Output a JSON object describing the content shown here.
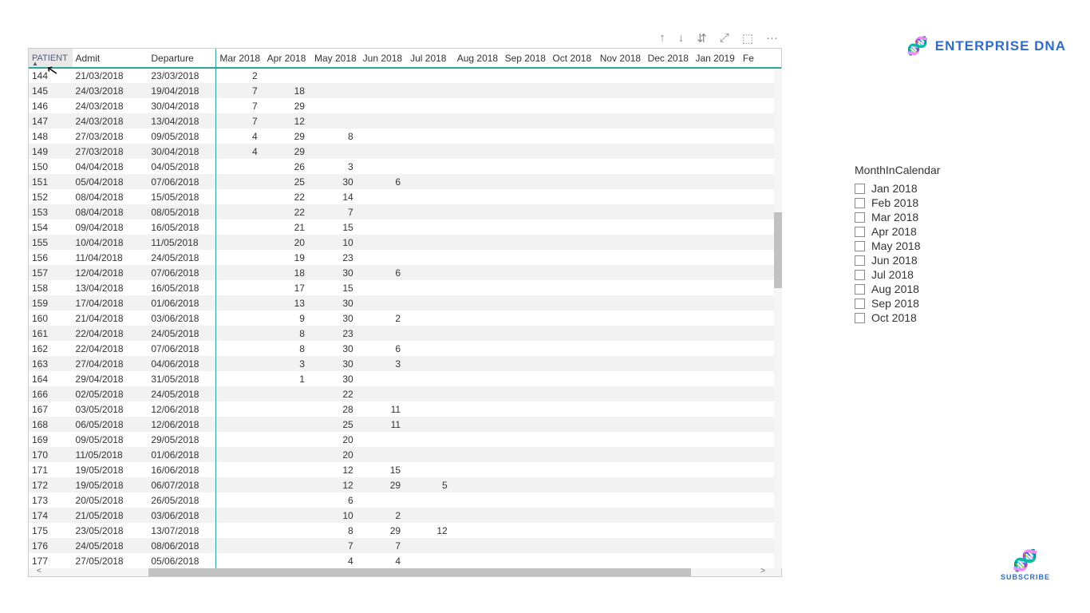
{
  "brand": {
    "left": "ENTERPRISE",
    "right": "DNA"
  },
  "subscribe": "SUBSCRIBE",
  "toolbar": {
    "up": "↑",
    "down": "↓",
    "drill": "⇵",
    "expand": "⤢",
    "focus": "⬚",
    "more": "···"
  },
  "slicer": {
    "title": "MonthInCalendar",
    "options": [
      "Jan 2018",
      "Feb 2018",
      "Mar 2018",
      "Apr 2018",
      "May 2018",
      "Jun 2018",
      "Jul 2018",
      "Aug 2018",
      "Sep 2018",
      "Oct 2018"
    ]
  },
  "columns": {
    "patient": "PATIENT",
    "admit": "Admit",
    "departure": "Departure",
    "months": [
      "Mar 2018",
      "Apr 2018",
      "May 2018",
      "Jun 2018",
      "Jul 2018",
      "Aug 2018",
      "Sep 2018",
      "Oct 2018",
      "Nov 2018",
      "Dec 2018",
      "Jan 2019",
      "Fe"
    ]
  },
  "rows": [
    {
      "p": "144",
      "a": "21/03/2018",
      "d": "23/03/2018",
      "m": {
        "0": "2"
      }
    },
    {
      "p": "145",
      "a": "24/03/2018",
      "d": "19/04/2018",
      "m": {
        "0": "7",
        "1": "18"
      }
    },
    {
      "p": "146",
      "a": "24/03/2018",
      "d": "30/04/2018",
      "m": {
        "0": "7",
        "1": "29"
      }
    },
    {
      "p": "147",
      "a": "24/03/2018",
      "d": "13/04/2018",
      "m": {
        "0": "7",
        "1": "12"
      }
    },
    {
      "p": "148",
      "a": "27/03/2018",
      "d": "09/05/2018",
      "m": {
        "0": "4",
        "1": "29",
        "2": "8"
      }
    },
    {
      "p": "149",
      "a": "27/03/2018",
      "d": "30/04/2018",
      "m": {
        "0": "4",
        "1": "29"
      }
    },
    {
      "p": "150",
      "a": "04/04/2018",
      "d": "04/05/2018",
      "m": {
        "1": "26",
        "2": "3"
      }
    },
    {
      "p": "151",
      "a": "05/04/2018",
      "d": "07/06/2018",
      "m": {
        "1": "25",
        "2": "30",
        "3": "6"
      }
    },
    {
      "p": "152",
      "a": "08/04/2018",
      "d": "15/05/2018",
      "m": {
        "1": "22",
        "2": "14"
      }
    },
    {
      "p": "153",
      "a": "08/04/2018",
      "d": "08/05/2018",
      "m": {
        "1": "22",
        "2": "7"
      }
    },
    {
      "p": "154",
      "a": "09/04/2018",
      "d": "16/05/2018",
      "m": {
        "1": "21",
        "2": "15"
      }
    },
    {
      "p": "155",
      "a": "10/04/2018",
      "d": "11/05/2018",
      "m": {
        "1": "20",
        "2": "10"
      }
    },
    {
      "p": "156",
      "a": "11/04/2018",
      "d": "24/05/2018",
      "m": {
        "1": "19",
        "2": "23"
      }
    },
    {
      "p": "157",
      "a": "12/04/2018",
      "d": "07/06/2018",
      "m": {
        "1": "18",
        "2": "30",
        "3": "6"
      }
    },
    {
      "p": "158",
      "a": "13/04/2018",
      "d": "16/05/2018",
      "m": {
        "1": "17",
        "2": "15"
      }
    },
    {
      "p": "159",
      "a": "17/04/2018",
      "d": "01/06/2018",
      "m": {
        "1": "13",
        "2": "30"
      }
    },
    {
      "p": "160",
      "a": "21/04/2018",
      "d": "03/06/2018",
      "m": {
        "1": "9",
        "2": "30",
        "3": "2"
      }
    },
    {
      "p": "161",
      "a": "22/04/2018",
      "d": "24/05/2018",
      "m": {
        "1": "8",
        "2": "23"
      }
    },
    {
      "p": "162",
      "a": "22/04/2018",
      "d": "07/06/2018",
      "m": {
        "1": "8",
        "2": "30",
        "3": "6"
      }
    },
    {
      "p": "163",
      "a": "27/04/2018",
      "d": "04/06/2018",
      "m": {
        "1": "3",
        "2": "30",
        "3": "3"
      }
    },
    {
      "p": "164",
      "a": "29/04/2018",
      "d": "31/05/2018",
      "m": {
        "1": "1",
        "2": "30"
      }
    },
    {
      "p": "166",
      "a": "02/05/2018",
      "d": "24/05/2018",
      "m": {
        "2": "22"
      }
    },
    {
      "p": "167",
      "a": "03/05/2018",
      "d": "12/06/2018",
      "m": {
        "2": "28",
        "3": "11"
      }
    },
    {
      "p": "168",
      "a": "06/05/2018",
      "d": "12/06/2018",
      "m": {
        "2": "25",
        "3": "11"
      }
    },
    {
      "p": "169",
      "a": "09/05/2018",
      "d": "29/05/2018",
      "m": {
        "2": "20"
      }
    },
    {
      "p": "170",
      "a": "11/05/2018",
      "d": "01/06/2018",
      "m": {
        "2": "20"
      }
    },
    {
      "p": "171",
      "a": "19/05/2018",
      "d": "16/06/2018",
      "m": {
        "2": "12",
        "3": "15"
      }
    },
    {
      "p": "172",
      "a": "19/05/2018",
      "d": "06/07/2018",
      "m": {
        "2": "12",
        "3": "29",
        "4": "5"
      }
    },
    {
      "p": "173",
      "a": "20/05/2018",
      "d": "26/05/2018",
      "m": {
        "2": "6"
      }
    },
    {
      "p": "174",
      "a": "21/05/2018",
      "d": "03/06/2018",
      "m": {
        "2": "10",
        "3": "2"
      }
    },
    {
      "p": "175",
      "a": "23/05/2018",
      "d": "13/07/2018",
      "m": {
        "2": "8",
        "3": "29",
        "4": "12"
      }
    },
    {
      "p": "176",
      "a": "24/05/2018",
      "d": "08/06/2018",
      "m": {
        "2": "7",
        "3": "7"
      }
    },
    {
      "p": "177",
      "a": "27/05/2018",
      "d": "05/06/2018",
      "m": {
        "2": "4",
        "3": "4"
      }
    }
  ]
}
